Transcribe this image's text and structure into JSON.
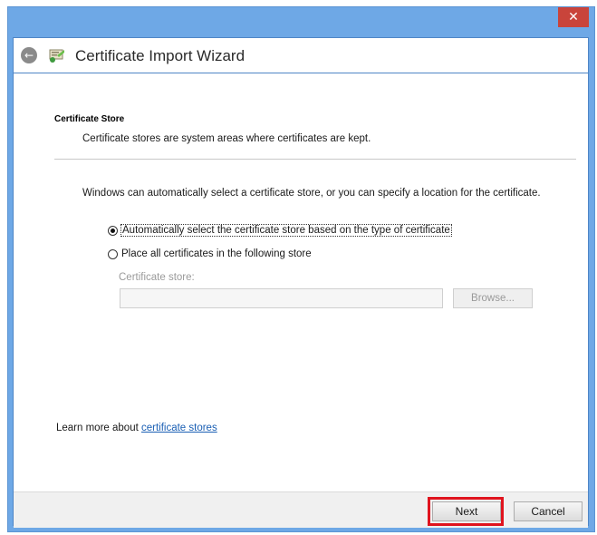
{
  "window": {
    "title": "Certificate Import Wizard",
    "close_symbol": "✕"
  },
  "header": {
    "title": "Certificate Store",
    "description": "Certificate stores are system areas where certificates are kept."
  },
  "body": {
    "intro": "Windows can automatically select a certificate store, or you can specify a location for the certificate.",
    "options": [
      {
        "label": "Automatically select the certificate store based on the type of certificate",
        "selected": true
      },
      {
        "label": "Place all certificates in the following store",
        "selected": false
      }
    ],
    "store_label": "Certificate store:",
    "store_value": "",
    "browse_label": "Browse..."
  },
  "learn_more": {
    "prefix": "Learn more about ",
    "link": "certificate stores"
  },
  "footer": {
    "next_label": "Next",
    "cancel_label": "Cancel"
  },
  "colors": {
    "window_frame": "#6ea8e6",
    "close_button": "#c9443b",
    "highlight_box": "#e0141e",
    "link": "#1a5fb4"
  },
  "icons": {
    "back": "back-arrow-icon",
    "wizard": "certificate-icon",
    "close": "close-icon"
  }
}
